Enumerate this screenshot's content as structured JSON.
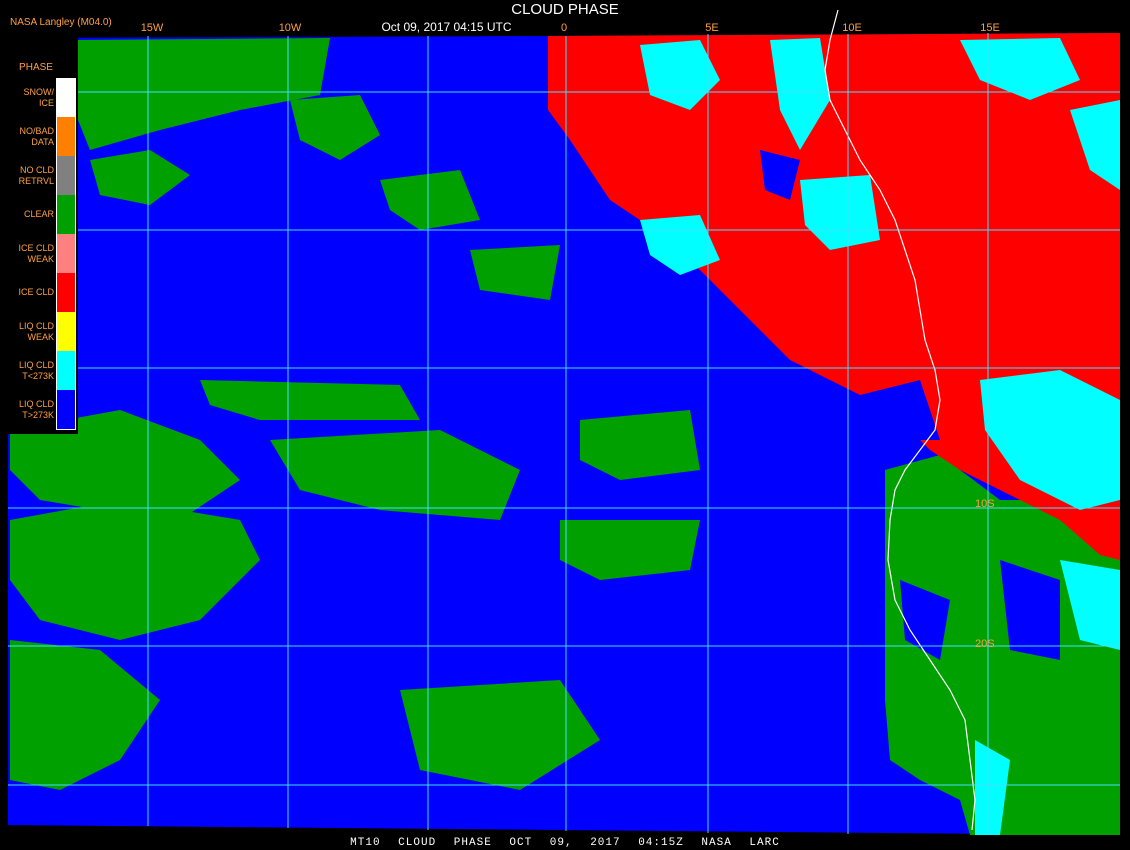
{
  "title": "CLOUD PHASE",
  "subtitle": "Oct 09, 2017 04:15 UTC",
  "credit": "NASA Langley (M04.0)",
  "footer": "MT10 CLOUD PHASE OCT 09, 2017 04:15Z NASA LARC",
  "longitude_labels": [
    "15W",
    "10W",
    "0",
    "5E",
    "10E",
    "15E"
  ],
  "latitude_labels": [
    "10S",
    "20S"
  ],
  "legend": {
    "title": "PHASE",
    "items": [
      {
        "label": "SNOW/\nICE",
        "color": "#ffffff"
      },
      {
        "label": "NO/BAD\nDATA",
        "color": "#ff8000"
      },
      {
        "label": "NO CLD\nRETRVL",
        "color": "#808080"
      },
      {
        "label": "CLEAR",
        "color": "#00a000"
      },
      {
        "label": "ICE CLD\nWEAK",
        "color": "#ff8080"
      },
      {
        "label": "ICE CLD",
        "color": "#ff0000"
      },
      {
        "label": "LIQ CLD\nWEAK",
        "color": "#ffff00"
      },
      {
        "label": "LIQ CLD\nT<273K",
        "color": "#00ffff"
      },
      {
        "label": "LIQ CLD\nT>273K",
        "color": "#0000ff"
      }
    ]
  },
  "colors": {
    "ocean_liquid_cloud": "#0000ff",
    "clear": "#00a000",
    "ice_cloud": "#ff0000",
    "liquid_cold": "#00ffff",
    "grid": "#40e0ff",
    "coastline": "#ffffff"
  }
}
